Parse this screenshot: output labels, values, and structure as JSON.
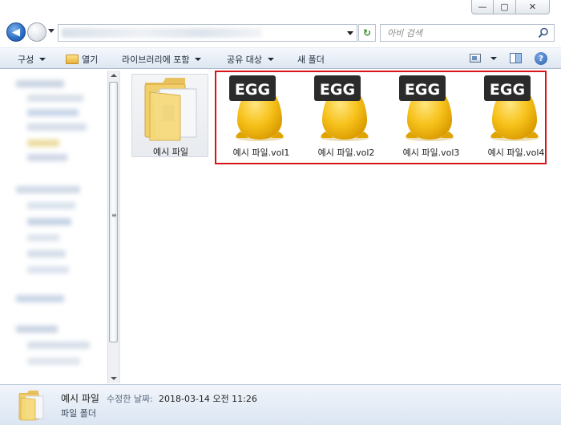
{
  "window": {
    "minimize_glyph": "—",
    "maximize_glyph": "▢",
    "close_glyph": "✕"
  },
  "address_bar": {
    "search_placeholder": "아비 검색",
    "refresh_glyph": "↻"
  },
  "toolbar": {
    "organize_label": "구성",
    "open_label": "열기",
    "include_library_label": "라이브러리에 포함",
    "share_with_label": "공유 대상",
    "new_folder_label": "새 폴더",
    "help_glyph": "?"
  },
  "files": [
    {
      "name": "예시 파일",
      "type": "folder",
      "icon": "folder-icon"
    },
    {
      "name": "예시 파일.vol1",
      "type": "egg",
      "icon": "egg-archive-icon",
      "badge": "EGG"
    },
    {
      "name": "예시 파일.vol2",
      "type": "egg",
      "icon": "egg-archive-icon",
      "badge": "EGG"
    },
    {
      "name": "예시 파일.vol3",
      "type": "egg",
      "icon": "egg-archive-icon",
      "badge": "EGG"
    },
    {
      "name": "예시 파일.vol4",
      "type": "egg",
      "icon": "egg-archive-icon",
      "badge": "EGG"
    }
  ],
  "details": {
    "name": "예시 파일",
    "modified_label": "수정한 날짜:",
    "modified_value": "2018-03-14 오전 11:26",
    "type": "파일 폴더"
  },
  "colors": {
    "highlight_border": "#d7141a",
    "egg_yellow": "#f7c21b",
    "egg_badge": "#2b2b2b"
  }
}
